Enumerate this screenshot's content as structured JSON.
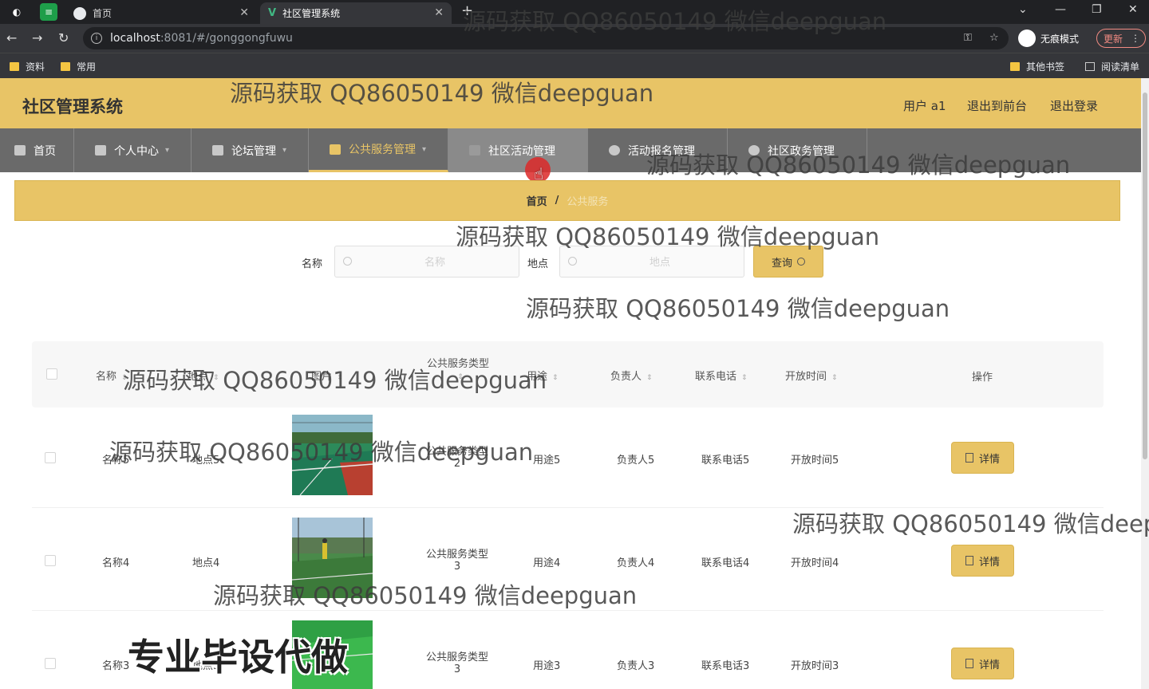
{
  "browser": {
    "tabs": [
      {
        "title": "首页",
        "active": false
      },
      {
        "title": "社区管理系统",
        "active": true
      }
    ],
    "url_host": "localhost",
    "url_path": ":8081/#/gonggongfuwu",
    "profile_label": "无痕模式",
    "update_label": "更新",
    "bookmarks": [
      "资料",
      "常用"
    ],
    "bookmarks_right": [
      "其他书签",
      "阅读清单"
    ]
  },
  "header": {
    "title": "社区管理系统",
    "user": "用户 a1",
    "front_link": "退出到前台",
    "logout": "退出登录"
  },
  "menu": [
    {
      "label": "首页"
    },
    {
      "label": "个人中心"
    },
    {
      "label": "论坛管理"
    },
    {
      "label": "公共服务管理"
    },
    {
      "label": "社区活动管理"
    },
    {
      "label": "活动报名管理"
    },
    {
      "label": "社区政务管理"
    }
  ],
  "breadcrumb": {
    "home": "首页",
    "sep": "/",
    "current": "公共服务"
  },
  "search": {
    "name_label": "名称",
    "name_placeholder": "名称",
    "place_label": "地点",
    "place_placeholder": "地点",
    "query_label": "查询"
  },
  "table": {
    "headers": {
      "name": "名称",
      "place": "地点",
      "image": "图片",
      "type": "公共服务类型",
      "usage": "用途",
      "owner": "负责人",
      "phone": "联系电话",
      "open_time": "开放时间",
      "action": "操作"
    },
    "rows": [
      {
        "name": "名称5",
        "place": "地点5",
        "type_line1": "公共服务类型",
        "type_line2": "2",
        "usage": "用途5",
        "owner": "负责人5",
        "phone": "联系电话5",
        "open_time": "开放时间5",
        "action": "详情"
      },
      {
        "name": "名称4",
        "place": "地点4",
        "type_line1": "公共服务类型",
        "type_line2": "3",
        "usage": "用途4",
        "owner": "负责人4",
        "phone": "联系电话4",
        "open_time": "开放时间4",
        "action": "详情"
      },
      {
        "name": "名称3",
        "place": "地点3",
        "type_line1": "公共服务类型",
        "type_line2": "3",
        "usage": "用途3",
        "owner": "负责人3",
        "phone": "联系电话3",
        "open_time": "开放时间3",
        "action": "详情"
      }
    ]
  },
  "watermark": "源码获取 QQ86050149 微信deepguan",
  "watermark_cut": "源码获取 QQ86050149 微信deep",
  "overlay_text": "专业毕设代做"
}
